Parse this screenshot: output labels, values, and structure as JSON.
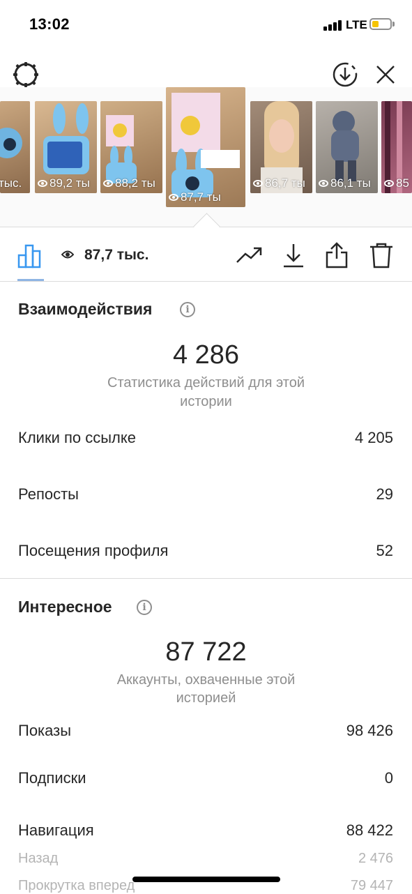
{
  "status_bar": {
    "time": "13:02",
    "network": "LTE"
  },
  "stories": [
    {
      "views": "тыс."
    },
    {
      "views": "89,2 ты"
    },
    {
      "views": "88,2 ты"
    },
    {
      "views": "87,7 ты",
      "active": true
    },
    {
      "views": "86,7 ты"
    },
    {
      "views": "86,1 ты"
    },
    {
      "views": "85"
    }
  ],
  "actionbar": {
    "views": "87,7 тыс."
  },
  "interactions": {
    "title": "Взаимодействия",
    "total": "4 286",
    "caption_line1": "Статистика действий для этой",
    "caption_line2": "истории",
    "rows": [
      {
        "label": "Клики по ссылке",
        "value": "4 205"
      },
      {
        "label": "Репосты",
        "value": "29"
      },
      {
        "label": "Посещения профиля",
        "value": "52"
      }
    ]
  },
  "discovery": {
    "title": "Интересное",
    "total": "87 722",
    "caption_line1": "Аккаунты, охваченные этой",
    "caption_line2": "историей",
    "rows": [
      {
        "label": "Показы",
        "value": "98 426"
      },
      {
        "label": "Подписки",
        "value": "0"
      },
      {
        "label": "Навигация",
        "value": "88 422"
      }
    ],
    "sub_rows": [
      {
        "label": "Назад",
        "value": "2 476"
      },
      {
        "label": "Прокрутка вперед",
        "value": "79 447"
      }
    ]
  },
  "colors": {
    "accent": "#3897f0",
    "battery": "#f5c400",
    "muted": "#8e8e8e"
  }
}
